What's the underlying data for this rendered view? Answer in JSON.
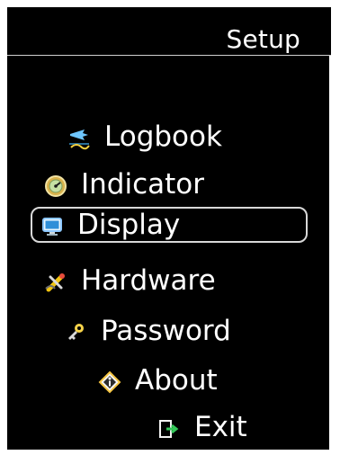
{
  "screen": {
    "title": "Setup"
  },
  "menu": {
    "items": [
      {
        "label": "Logbook",
        "icon": "logbook-icon"
      },
      {
        "label": "Indicator",
        "icon": "indicator-icon"
      },
      {
        "label": "Display",
        "icon": "display-icon",
        "selected": true
      },
      {
        "label": "Hardware",
        "icon": "hardware-icon"
      },
      {
        "label": "Password",
        "icon": "password-icon"
      },
      {
        "label": "About",
        "icon": "about-icon"
      },
      {
        "label": "Exit",
        "icon": "exit-icon"
      }
    ]
  },
  "colors": {
    "background": "#000000",
    "text": "#ffffff",
    "selection_border": "#d8d8d8"
  }
}
